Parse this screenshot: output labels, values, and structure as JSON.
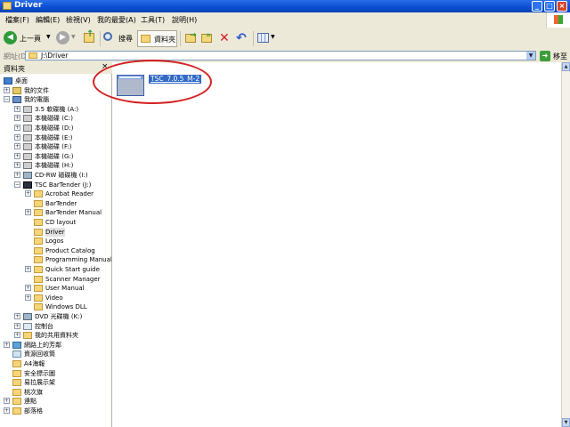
{
  "window": {
    "title": "Driver",
    "minimize": "_",
    "maximize": "□",
    "close": "×"
  },
  "menu": [
    "檔案(F)",
    "編輯(E)",
    "檢視(V)",
    "我的最愛(A)",
    "工具(T)",
    "說明(H)"
  ],
  "toolbar": {
    "back_label": "上一頁",
    "search_label": "搜尋",
    "folders_label": "資料夾"
  },
  "address": {
    "label": "網址(D)",
    "value": "J:\\Driver",
    "go_label": "移至"
  },
  "tree_pane": {
    "title": "資料夾",
    "close": "×"
  },
  "tree": {
    "items": [
      {
        "label": "桌面",
        "expander": "",
        "icon": "desktop-icon"
      },
      {
        "label": "我的文件",
        "expander": "+",
        "icon": "documents-icon"
      },
      {
        "label": "我的電腦",
        "expander": "−",
        "icon": "computer-icon"
      },
      {
        "label": "3.5 軟碟機 (A:)",
        "expander": "+",
        "icon": "floppy-icon"
      },
      {
        "label": "本機磁碟 (C:)",
        "expander": "+",
        "icon": "drive-icon"
      },
      {
        "label": "本機磁碟 (D:)",
        "expander": "+",
        "icon": "drive-icon"
      },
      {
        "label": "本機磁碟 (E:)",
        "expander": "+",
        "icon": "drive-icon"
      },
      {
        "label": "本機磁碟 (F:)",
        "expander": "+",
        "icon": "drive-icon"
      },
      {
        "label": "本機磁碟 (G:)",
        "expander": "+",
        "icon": "drive-icon"
      },
      {
        "label": "本機磁碟 (H:)",
        "expander": "+",
        "icon": "drive-icon"
      },
      {
        "label": "CD-RW 磁碟機 (I:)",
        "expander": "+",
        "icon": "cd-drive-icon"
      },
      {
        "label": "TSC BarTender (J:)",
        "expander": "−",
        "icon": "tsc-drive-icon"
      },
      {
        "label": "Acrobat Reader",
        "expander": "+",
        "icon": "folder-icon"
      },
      {
        "label": "BarTender",
        "expander": "",
        "icon": "folder-icon"
      },
      {
        "label": "BarTender Manual",
        "expander": "+",
        "icon": "folder-icon"
      },
      {
        "label": "CD layout",
        "expander": "",
        "icon": "folder-icon"
      },
      {
        "label": "Driver",
        "expander": "",
        "icon": "folder-icon"
      },
      {
        "label": "Logos",
        "expander": "",
        "icon": "folder-icon"
      },
      {
        "label": "Product Catalog",
        "expander": "",
        "icon": "folder-icon"
      },
      {
        "label": "Programming Manual",
        "expander": "",
        "icon": "folder-icon"
      },
      {
        "label": "Quick Start guide",
        "expander": "+",
        "icon": "folder-icon"
      },
      {
        "label": "Scanner Manager",
        "expander": "",
        "icon": "folder-icon"
      },
      {
        "label": "User Manual",
        "expander": "+",
        "icon": "folder-icon"
      },
      {
        "label": "Video",
        "expander": "+",
        "icon": "folder-icon"
      },
      {
        "label": "Windows DLL",
        "expander": "",
        "icon": "folder-icon"
      },
      {
        "label": "DVD 光碟機 (K:)",
        "expander": "+",
        "icon": "cd-drive-icon"
      },
      {
        "label": "控制台",
        "expander": "+",
        "icon": "control-panel-icon"
      },
      {
        "label": "我的共用資料夾",
        "expander": "+",
        "icon": "shared-folder-icon"
      },
      {
        "label": "網路上的芳鄰",
        "expander": "+",
        "icon": "network-icon"
      },
      {
        "label": "資源回收筒",
        "expander": "",
        "icon": "recycle-bin-icon"
      },
      {
        "label": "A4海報",
        "expander": "",
        "icon": "folder-icon"
      },
      {
        "label": "安全標示圖",
        "expander": "",
        "icon": "folder-icon"
      },
      {
        "label": "易拉展示架",
        "expander": "",
        "icon": "folder-icon"
      },
      {
        "label": "桃次旗",
        "expander": "",
        "icon": "folder-icon"
      },
      {
        "label": "連點",
        "expander": "+",
        "icon": "folder-icon"
      },
      {
        "label": "部落格",
        "expander": "+",
        "icon": "folder-icon"
      }
    ],
    "selected": "Driver"
  },
  "files": [
    {
      "name": "TSC_7.0.5_M-2",
      "icon": "installer-icon"
    }
  ],
  "colors": {
    "titlebar": "#0a4fd4",
    "selection": "#316ac5",
    "annotation": "#d42020",
    "chrome": "#ece9d8"
  }
}
